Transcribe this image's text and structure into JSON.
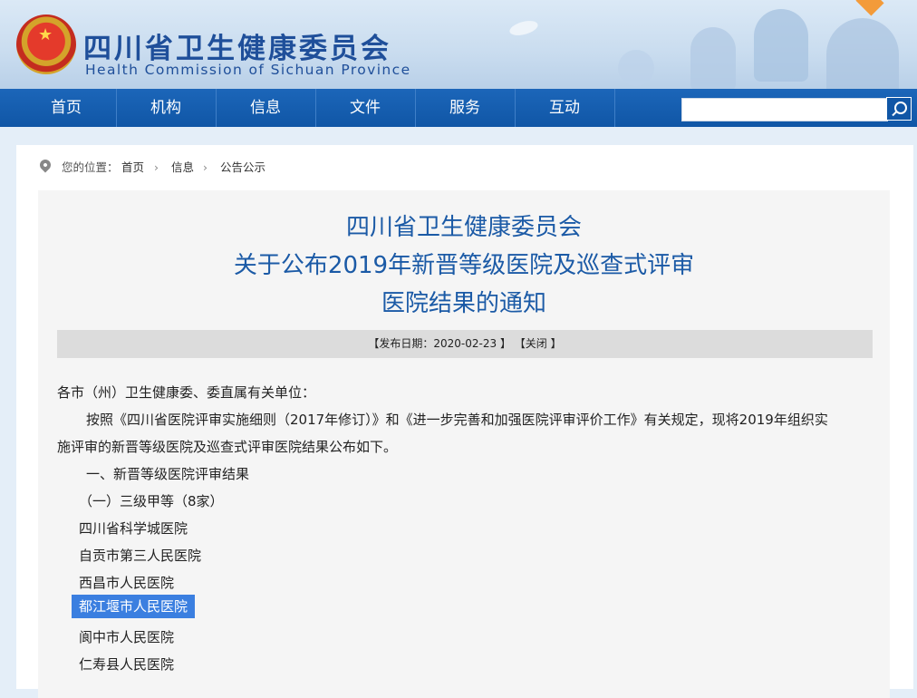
{
  "header": {
    "site_title": "四川省卫生健康委员会",
    "site_subtitle": "Health Commission of Sichuan Province"
  },
  "nav": {
    "items": [
      "首页",
      "机构",
      "信息",
      "文件",
      "服务",
      "互动"
    ]
  },
  "search": {
    "placeholder": "",
    "value": ""
  },
  "breadcrumb": {
    "prefix": "您的位置：",
    "items": [
      "首页",
      "信息",
      "公告公示"
    ],
    "separator": "›"
  },
  "article": {
    "title_line1": "四川省卫生健康委员会",
    "title_line2": "关于公布2019年新晋等级医院及巡查式评审",
    "title_line3": "医院结果的通知",
    "meta_date": "【发布日期：2020-02-23 】",
    "meta_close": "【关闭 】",
    "salutation": "各市（州）卫生健康委、委直属有关单位：",
    "para1_line1": "按照《四川省医院评审实施细则（2017年修订）》和《进一步完善和加强医院评审评价工作》有关规定，现将2019年组织实",
    "para1_line2": "施评审的新晋等级医院及巡查式评审医院结果公布如下。",
    "section1": "一、新晋等级医院评审结果",
    "subsection1": "（一）三级甲等（8家）",
    "hospitals": [
      "四川省科学城医院",
      "自贡市第三人民医院",
      "西昌市人民医院",
      "都江堰市人民医院",
      "阆中市人民医院",
      "仁寿县人民医院"
    ]
  },
  "colors": {
    "nav_bg": "#1056a6",
    "title_blue": "#1b5aa6",
    "selection": "#3b7fe0"
  }
}
